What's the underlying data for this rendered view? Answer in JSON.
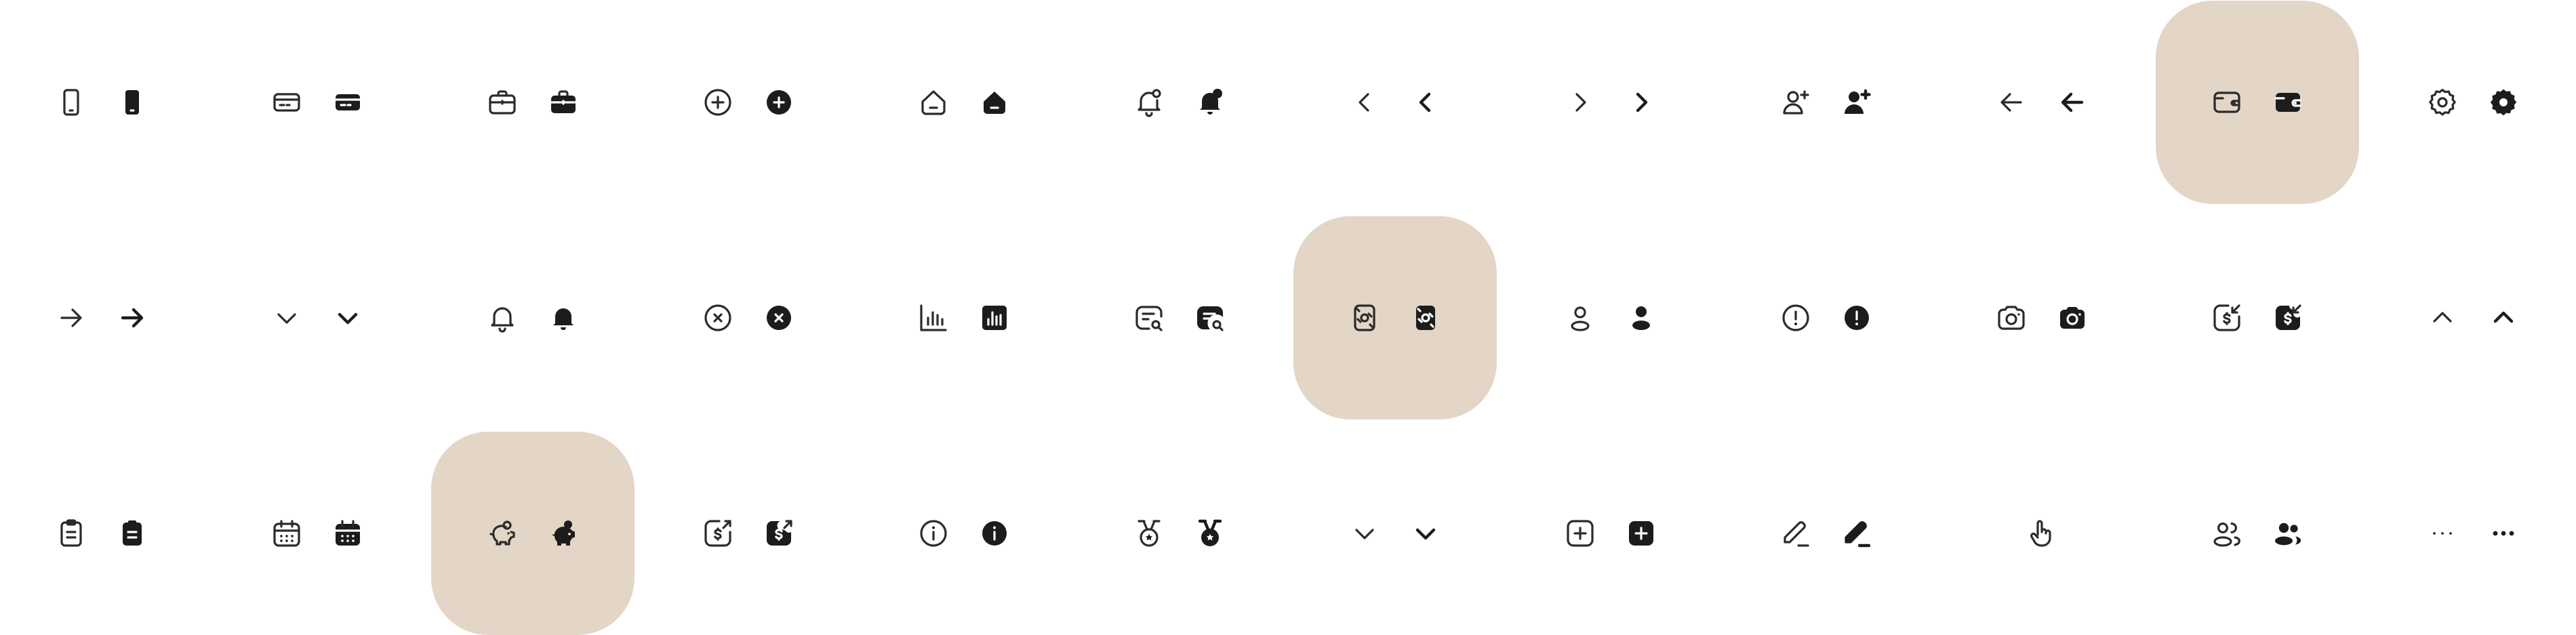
{
  "sheet": {
    "highlight_color": "#e3d6c7",
    "icon_color": "#1c1c1c",
    "rows": [
      [
        {
          "name": "mobile",
          "highlighted": false
        },
        {
          "name": "credit-card",
          "highlighted": false
        },
        {
          "name": "briefcase",
          "highlighted": false
        },
        {
          "name": "plus-circle",
          "highlighted": false
        },
        {
          "name": "home-minus",
          "highlighted": false
        },
        {
          "name": "bell-notification",
          "highlighted": false
        },
        {
          "name": "chevron-left",
          "highlighted": false
        },
        {
          "name": "chevron-right",
          "highlighted": false
        },
        {
          "name": "user-add",
          "highlighted": false
        },
        {
          "name": "arrow-left",
          "highlighted": false
        },
        {
          "name": "wallet",
          "highlighted": true
        },
        {
          "name": "settings",
          "highlighted": false
        }
      ],
      [
        {
          "name": "arrow-right",
          "highlighted": false
        },
        {
          "name": "chevron-down",
          "highlighted": false
        },
        {
          "name": "bell",
          "highlighted": false
        },
        {
          "name": "x-circle",
          "highlighted": false
        },
        {
          "name": "bar-chart",
          "highlighted": false
        },
        {
          "name": "message-search",
          "highlighted": false
        },
        {
          "name": "money-transfer",
          "highlighted": true
        },
        {
          "name": "user",
          "highlighted": false
        },
        {
          "name": "alert-circle",
          "highlighted": false
        },
        {
          "name": "camera",
          "highlighted": false
        },
        {
          "name": "dollar-receive",
          "highlighted": false
        },
        {
          "name": "chevron-up",
          "highlighted": false
        }
      ],
      [
        {
          "name": "clipboard",
          "highlighted": false
        },
        {
          "name": "calendar",
          "highlighted": false
        },
        {
          "name": "piggy-bank",
          "highlighted": true
        },
        {
          "name": "dollar-send",
          "highlighted": false
        },
        {
          "name": "info-circle",
          "highlighted": false
        },
        {
          "name": "medal",
          "highlighted": false
        },
        {
          "name": "chevron-down-2",
          "highlighted": false
        },
        {
          "name": "plus-square",
          "highlighted": false
        },
        {
          "name": "edit-pen",
          "highlighted": false
        },
        {
          "name": "hand-pointer",
          "highlighted": false
        },
        {
          "name": "users",
          "highlighted": false
        },
        {
          "name": "more-horizontal",
          "highlighted": false
        }
      ]
    ]
  }
}
